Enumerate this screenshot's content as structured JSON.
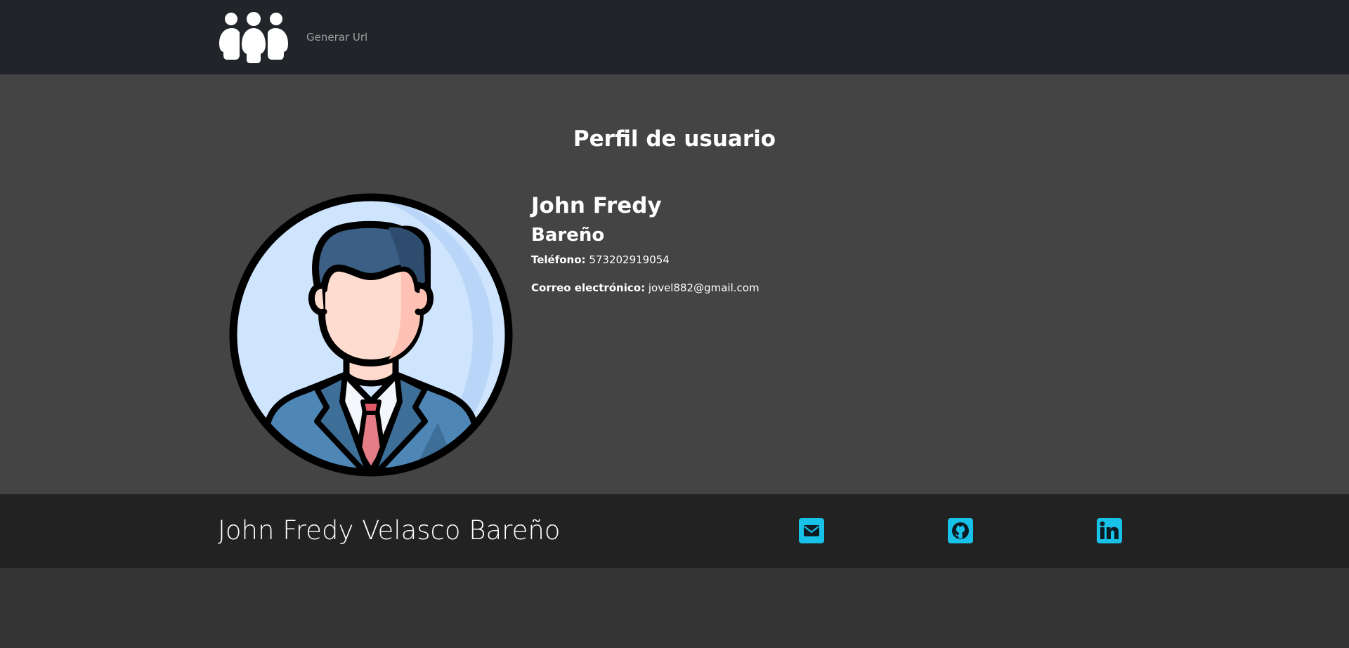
{
  "navbar": {
    "logo_icon": "users-group-icon",
    "links": [
      {
        "label": "Generar Url"
      }
    ]
  },
  "main": {
    "title": "Perfil de usuario",
    "avatar_icon": "businessman-avatar-icon",
    "profile": {
      "first_name": "John Fredy",
      "last_name": "Bareño",
      "phone_label": "Teléfono:",
      "phone_value": " 573202919054",
      "email_label": "Correo electrónico:",
      "email_value": " jovel882@gmail.com"
    }
  },
  "footer": {
    "name": "John Fredy Velasco Bareño",
    "social_icons": [
      "email-icon",
      "github-icon",
      "linkedin-icon"
    ],
    "icon_color": "#17c1e8"
  },
  "colors": {
    "navbar_bg": "#212529",
    "main_bg": "#444444",
    "footer_bg": "#222222",
    "page_bg": "#333333"
  }
}
